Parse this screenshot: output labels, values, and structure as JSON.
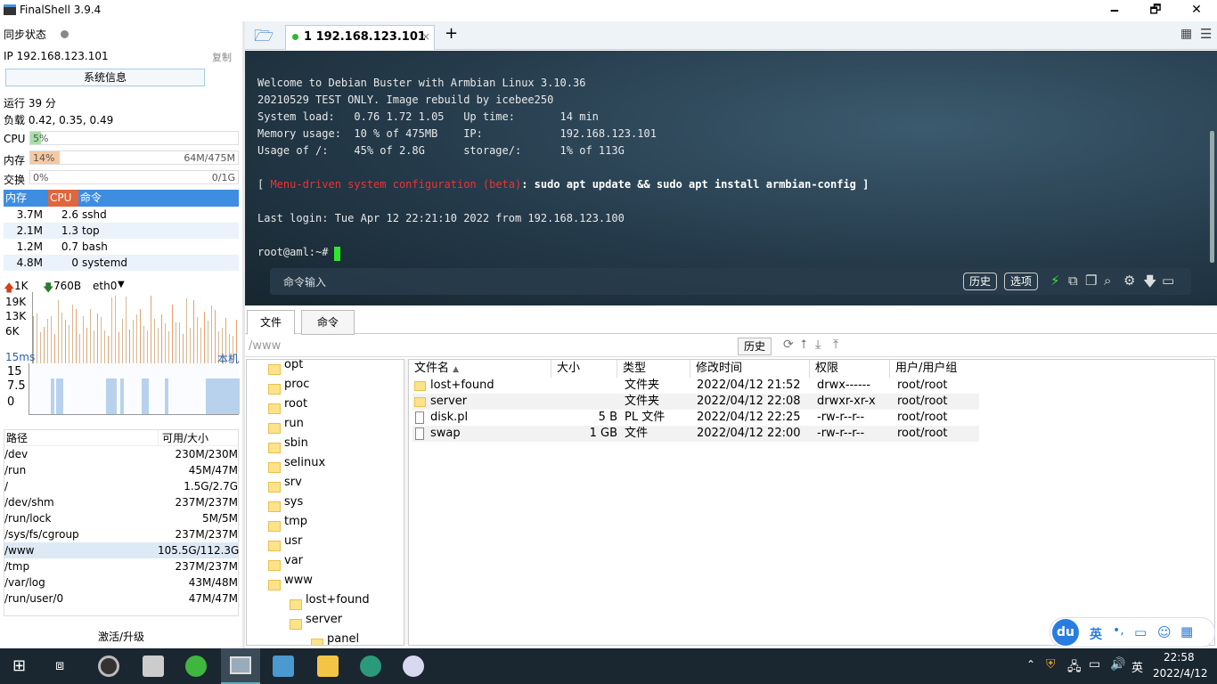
{
  "window": {
    "title": "FinalShell 3.9.4",
    "minimize": "🗕",
    "maximize": "🗗",
    "close": "✕"
  },
  "left": {
    "sync_label": "同步状态",
    "ip_label": "IP 192.168.123.101",
    "copy_label": "复制",
    "sysinfo_button": "系统信息",
    "uptime": "运行 39 分",
    "load": "负载 0.42, 0.35, 0.49",
    "cpu": {
      "label": "CPU",
      "pct": "5%",
      "amount": "",
      "fraction": 0.05
    },
    "mem": {
      "label": "内存",
      "pct": "14%",
      "amount": "64M/475M",
      "fraction": 0.14
    },
    "swap": {
      "label": "交换",
      "pct": "0%",
      "amount": "0/1G",
      "fraction": 0
    },
    "proc_headers": [
      "内存",
      "CPU",
      "命令"
    ],
    "processes": [
      {
        "mem": "3.7M",
        "cpu": "2.6",
        "cmd": "sshd"
      },
      {
        "mem": "2.1M",
        "cpu": "1.3",
        "cmd": "top"
      },
      {
        "mem": "1.2M",
        "cpu": "0.7",
        "cmd": "bash"
      },
      {
        "mem": "4.8M",
        "cpu": "0",
        "cmd": "systemd"
      }
    ],
    "net": {
      "up": "1K",
      "down": "760B",
      "iface": "eth0",
      "ticks": [
        "19K",
        "13K",
        "6K"
      ]
    },
    "ping": {
      "latency": "15ms",
      "local_label": "本机",
      "ticks": [
        "15",
        "7.5",
        "0"
      ]
    },
    "disk_headers": [
      "路径",
      "可用/大小"
    ],
    "disks": [
      {
        "path": "/dev",
        "avail": "230M/230M"
      },
      {
        "path": "/run",
        "avail": "45M/47M"
      },
      {
        "path": "/",
        "avail": "1.5G/2.7G"
      },
      {
        "path": "/dev/shm",
        "avail": "237M/237M"
      },
      {
        "path": "/run/lock",
        "avail": "5M/5M"
      },
      {
        "path": "/sys/fs/cgroup",
        "avail": "237M/237M"
      },
      {
        "path": "/www",
        "avail": "105.5G/112.3G"
      },
      {
        "path": "/tmp",
        "avail": "237M/237M"
      },
      {
        "path": "/var/log",
        "avail": "43M/48M"
      },
      {
        "path": "/run/user/0",
        "avail": "47M/47M"
      }
    ],
    "upgrade": "激活/升级"
  },
  "tabs": {
    "active_tab": "1 192.168.123.101",
    "close": "×",
    "add": "+"
  },
  "terminal": {
    "lines": [
      "Welcome to Debian Buster with Armbian Linux 3.10.36",
      "20210529 TEST ONLY. Image rebuild by icebee250",
      "System load:   0.76 1.72 1.05   Up time:       14 min",
      "Memory usage:  10 % of 475MB    IP:            192.168.123.101",
      "Usage of /:    45% of 2.8G      storage/:      1% of 113G",
      "",
      "Last login: Tue Apr 12 22:21:10 2022 from 192.168.123.100",
      "",
      "root@aml:~#"
    ],
    "menu_prefix": "[ ",
    "menu_red": "Menu-driven system configuration (beta)",
    "menu_rest": ": sudo apt update && sudo apt install armbian-config ]",
    "cmd_placeholder": "命令输入",
    "history_btn": "历史",
    "options_btn": "选项"
  },
  "files": {
    "tab_files": "文件",
    "tab_cmd": "命令",
    "path": "/www",
    "history_btn": "历史",
    "tree": [
      {
        "name": "opt",
        "level": 0
      },
      {
        "name": "proc",
        "level": 0
      },
      {
        "name": "root",
        "level": 0
      },
      {
        "name": "run",
        "level": 0
      },
      {
        "name": "sbin",
        "level": 0
      },
      {
        "name": "selinux",
        "level": 0
      },
      {
        "name": "srv",
        "level": 0
      },
      {
        "name": "sys",
        "level": 0
      },
      {
        "name": "tmp",
        "level": 0
      },
      {
        "name": "usr",
        "level": 0
      },
      {
        "name": "var",
        "level": 0
      },
      {
        "name": "www",
        "level": 0
      },
      {
        "name": "lost+found",
        "level": 1
      },
      {
        "name": "server",
        "level": 1
      },
      {
        "name": "panel",
        "level": 2
      }
    ],
    "columns": [
      "文件名",
      "大小",
      "类型",
      "修改时间",
      "权限",
      "用户/用户组"
    ],
    "rows": [
      {
        "name": "lost+found",
        "size": "",
        "type": "文件夹",
        "mtime": "2022/04/12 21:52",
        "perm": "drwx------",
        "owner": "root/root",
        "dir": true
      },
      {
        "name": "server",
        "size": "",
        "type": "文件夹",
        "mtime": "2022/04/12 22:08",
        "perm": "drwxr-xr-x",
        "owner": "root/root",
        "dir": true
      },
      {
        "name": "disk.pl",
        "size": "5 B",
        "type": "PL 文件",
        "mtime": "2022/04/12 22:25",
        "perm": "-rw-r--r--",
        "owner": "root/root",
        "dir": false
      },
      {
        "name": "swap",
        "size": "1 GB",
        "type": "文件",
        "mtime": "2022/04/12 22:00",
        "perm": "-rw-r--r--",
        "owner": "root/root",
        "dir": false
      }
    ]
  },
  "ime": {
    "logo": "du",
    "lang": "英",
    "punct": "•,"
  },
  "taskbar": {
    "time": "22:58",
    "date": "2022/4/12",
    "lang": "英"
  }
}
